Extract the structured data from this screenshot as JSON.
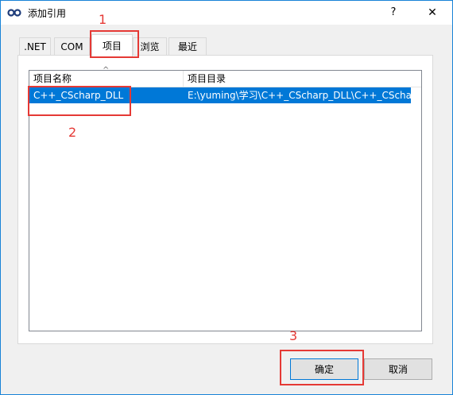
{
  "window": {
    "title": "添加引用",
    "help_label": "?",
    "close_label": "✕"
  },
  "tabs": [
    {
      "label": ".NET"
    },
    {
      "label": "COM"
    },
    {
      "label": "项目",
      "active": true
    },
    {
      "label": "浏览"
    },
    {
      "label": "最近"
    }
  ],
  "list": {
    "columns": [
      "项目名称",
      "项目目录"
    ],
    "rows": [
      {
        "name": "C++_CScharp_DLL",
        "path": "E:\\yuming\\学习\\C++_CScharp_DLL\\C++_CScha...",
        "selected": true
      }
    ]
  },
  "buttons": {
    "ok": "确定",
    "cancel": "取消"
  },
  "annotations": {
    "a1": "1",
    "a2": "2",
    "a3": "3",
    "color": "#e53935"
  },
  "colors": {
    "selection": "#0078d7",
    "window_border": "#1883d7"
  }
}
